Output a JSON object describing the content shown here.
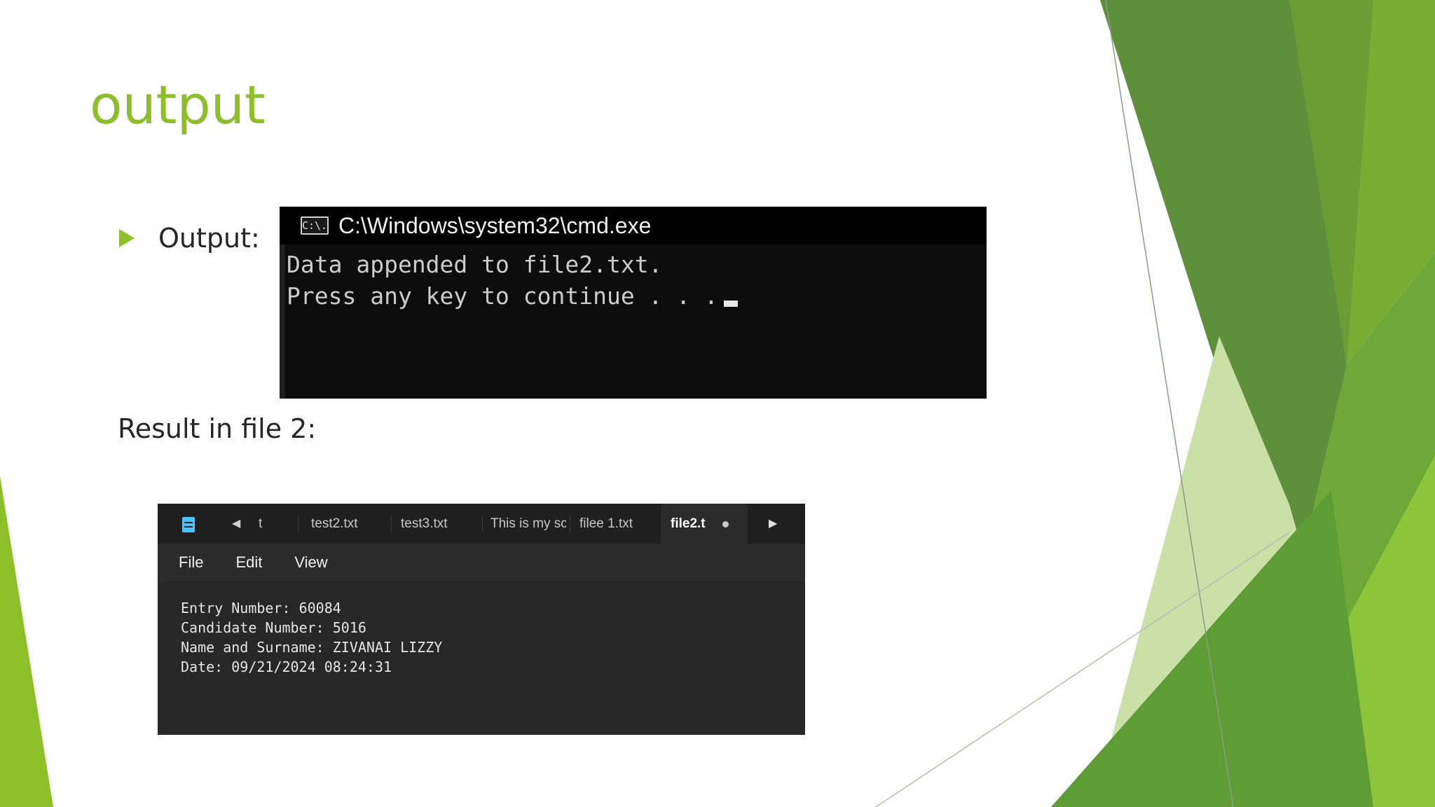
{
  "slide": {
    "title": "output",
    "bullet_label": "Output:",
    "result_label": "Result in file 2:"
  },
  "colors": {
    "accent_green": "#8cbf2a",
    "dark_green": "#5a8a3a",
    "light_green": "#a8d160"
  },
  "cmd_window": {
    "icon_text": "C:\\.",
    "title": "C:\\Windows\\system32\\cmd.exe",
    "lines": [
      "Data appended to file2.txt.",
      "Press any key to continue . . ."
    ]
  },
  "notepad": {
    "tabs": [
      {
        "label": "t"
      },
      {
        "label": "test2.txt"
      },
      {
        "label": "test3.txt"
      },
      {
        "label": "This is my sc"
      },
      {
        "label": "filee 1.txt"
      },
      {
        "label": "file2.t",
        "active": true
      }
    ],
    "menu": [
      "File",
      "Edit",
      "View"
    ],
    "lines": [
      "Entry Number: 60084",
      "Candidate Number: 5016",
      "Name and Surname: ZIVANAI LIZZY",
      "Date: 09/21/2024 08:24:31"
    ]
  }
}
